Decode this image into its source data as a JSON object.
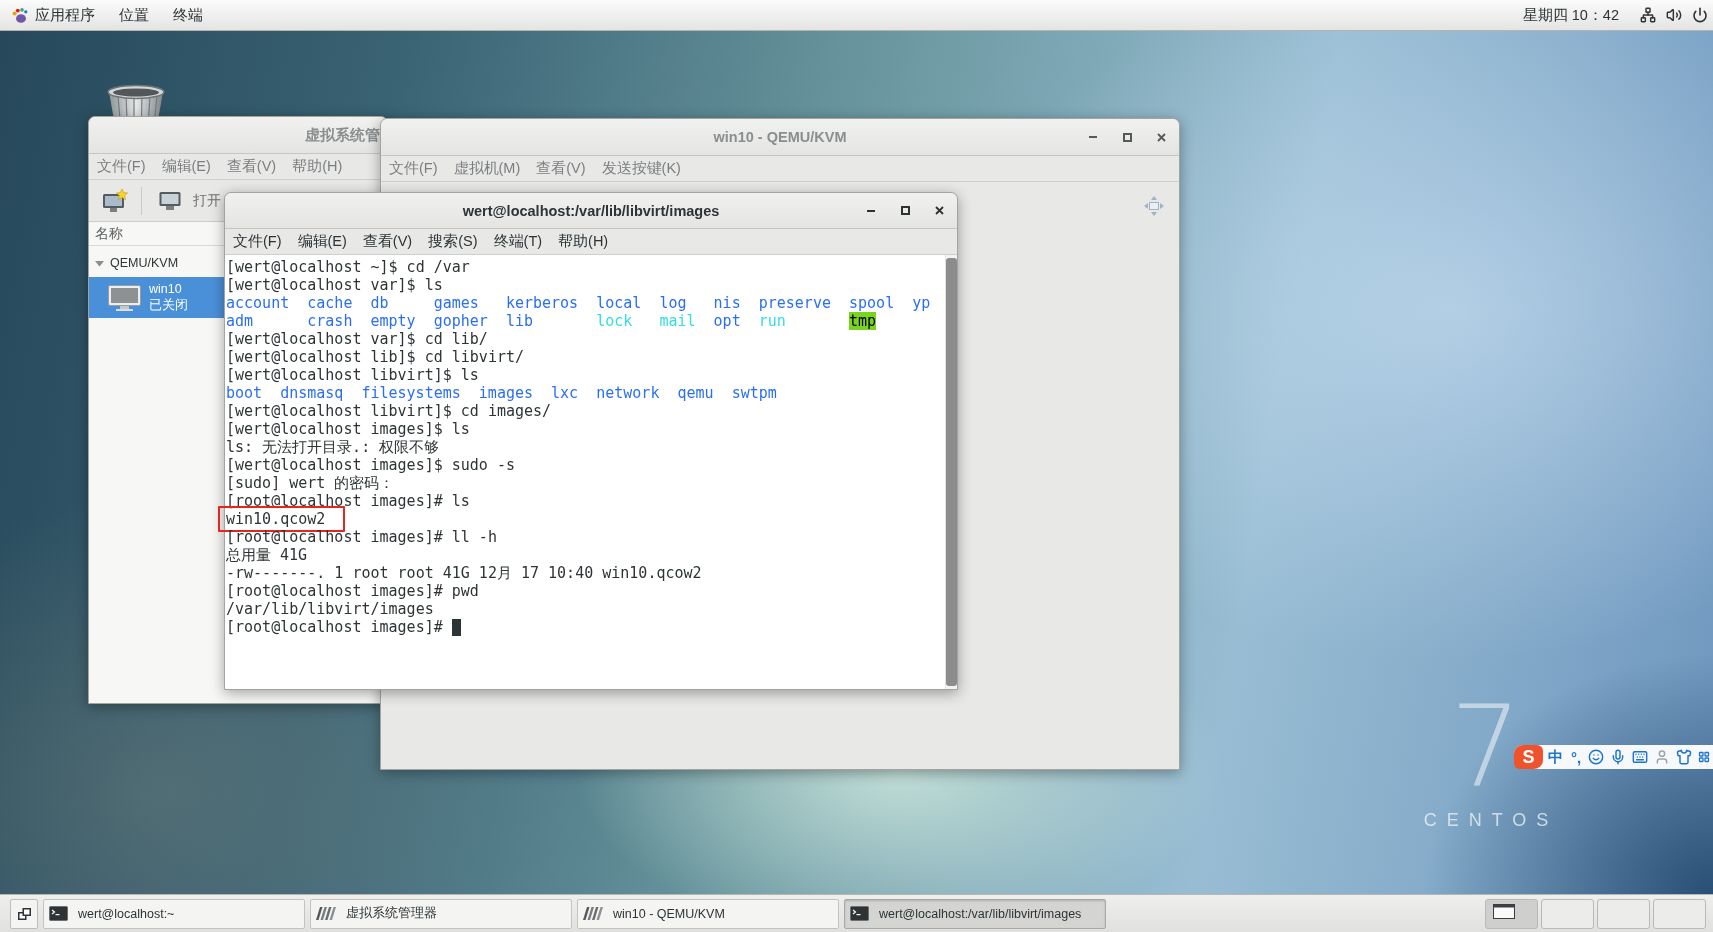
{
  "top_bar": {
    "menus": [
      "应用程序",
      "位置",
      "终端"
    ],
    "clock": "星期四 10：42"
  },
  "virt_manager": {
    "title": "虚拟系统管",
    "focused": false,
    "menu": [
      "文件(F)",
      "编辑(E)",
      "查看(V)",
      "帮助(H)"
    ],
    "toolbar": {
      "open_label": "打开"
    },
    "column": "名称",
    "tree": [
      {
        "label": "QEMU/KVM",
        "expanded": true,
        "children": [
          {
            "name": "win10",
            "status": "已关闭",
            "selected": true
          }
        ]
      }
    ]
  },
  "qemu_window": {
    "title": "win10 - QEMU/KVM",
    "focused": false,
    "menu": [
      "文件(F)",
      "虚拟机(M)",
      "查看(V)",
      "发送按键(K)"
    ]
  },
  "terminal": {
    "title": "wert@localhost:/var/lib/libvirt/images",
    "focused": true,
    "menu": [
      "文件(F)",
      "编辑(E)",
      "查看(V)",
      "搜索(S)",
      "终端(T)",
      "帮助(H)"
    ],
    "lines": [
      {
        "kind": "text",
        "text": "[wert@localhost ~]$ cd /var",
        "highlighted": false
      },
      {
        "kind": "text",
        "text": "[wert@localhost var]$ ls",
        "highlighted": false
      },
      {
        "kind": "listing",
        "rows": [
          [
            {
              "name": "account",
              "kind": "dir"
            },
            {
              "name": "cache",
              "kind": "dir"
            },
            {
              "name": "db",
              "kind": "dir"
            },
            {
              "name": "games",
              "kind": "dir"
            },
            {
              "name": "kerberos",
              "kind": "dir"
            },
            {
              "name": "local",
              "kind": "dir"
            },
            {
              "name": "log",
              "kind": "dir"
            },
            {
              "name": "nis",
              "kind": "dir"
            },
            {
              "name": "preserve",
              "kind": "dir"
            },
            {
              "name": "spool",
              "kind": "dir"
            },
            {
              "name": "yp",
              "kind": "dir"
            }
          ],
          [
            {
              "name": "adm",
              "kind": "dir"
            },
            {
              "name": "crash",
              "kind": "dir"
            },
            {
              "name": "empty",
              "kind": "dir"
            },
            {
              "name": "gopher",
              "kind": "dir"
            },
            {
              "name": "lib",
              "kind": "dir"
            },
            {
              "name": "lock",
              "kind": "link"
            },
            {
              "name": "mail",
              "kind": "link"
            },
            {
              "name": "opt",
              "kind": "dir"
            },
            {
              "name": "run",
              "kind": "link"
            },
            {
              "name": "tmp",
              "kind": "sticky"
            }
          ]
        ],
        "highlighted": false
      },
      {
        "kind": "text",
        "text": "[wert@localhost var]$ cd lib/",
        "highlighted": false
      },
      {
        "kind": "text",
        "text": "[wert@localhost lib]$ cd libvirt/",
        "highlighted": false
      },
      {
        "kind": "text",
        "text": "[wert@localhost libvirt]$ ls",
        "highlighted": false
      },
      {
        "kind": "listing",
        "rows": [
          [
            {
              "name": "boot",
              "kind": "dir"
            },
            {
              "name": "dnsmasq",
              "kind": "dir"
            },
            {
              "name": "filesystems",
              "kind": "dir"
            },
            {
              "name": "images",
              "kind": "dir"
            },
            {
              "name": "lxc",
              "kind": "dir"
            },
            {
              "name": "network",
              "kind": "dir"
            },
            {
              "name": "qemu",
              "kind": "dir"
            },
            {
              "name": "swtpm",
              "kind": "dir"
            }
          ]
        ],
        "highlighted": false
      },
      {
        "kind": "text",
        "text": "[wert@localhost libvirt]$ cd images/",
        "highlighted": false
      },
      {
        "kind": "text",
        "text": "[wert@localhost images]$ ls",
        "highlighted": false
      },
      {
        "kind": "text",
        "text": "ls: 无法打开目录.: 权限不够",
        "highlighted": false
      },
      {
        "kind": "text",
        "text": "[wert@localhost images]$ sudo -s",
        "highlighted": false
      },
      {
        "kind": "text",
        "text": "[sudo] wert 的密码：",
        "highlighted": false
      },
      {
        "kind": "text",
        "text": "[root@localhost images]# ls",
        "highlighted": false
      },
      {
        "kind": "text",
        "text": "win10.qcow2",
        "highlighted": true
      },
      {
        "kind": "text",
        "text": "[root@localhost images]# ll -h",
        "highlighted": false
      },
      {
        "kind": "text",
        "text": "总用量 41G",
        "highlighted": false
      },
      {
        "kind": "text",
        "text": "-rw-------. 1 root root 41G 12月 17 10:40 win10.qcow2",
        "highlighted": false
      },
      {
        "kind": "text",
        "text": "[root@localhost images]# pwd",
        "highlighted": false
      },
      {
        "kind": "text",
        "text": "/var/lib/libvirt/images",
        "highlighted": false
      },
      {
        "kind": "text",
        "text": "[root@localhost images]#",
        "highlighted": false
      }
    ],
    "cursor": true
  },
  "desktop": {
    "logo_numeral": "7",
    "logo_name": "CENTOS"
  },
  "ime_bar": {
    "logo": "S",
    "mode": "中",
    "punctuation": "°,"
  },
  "taskbar": {
    "tasks": [
      {
        "label": "wert@localhost:~",
        "kind": "terminal",
        "selected": false
      },
      {
        "label": "虚拟系统管理器",
        "kind": "vm",
        "selected": false
      },
      {
        "label": "win10 - QEMU/KVM",
        "kind": "vm",
        "selected": false
      },
      {
        "label": "wert@localhost:/var/lib/libvirt/images",
        "kind": "terminal",
        "selected": true
      }
    ],
    "workspaces": [
      {
        "selected": true,
        "has_windows": true
      },
      {
        "selected": false,
        "has_windows": false
      },
      {
        "selected": false,
        "has_windows": false
      },
      {
        "selected": false,
        "has_windows": false
      }
    ]
  }
}
